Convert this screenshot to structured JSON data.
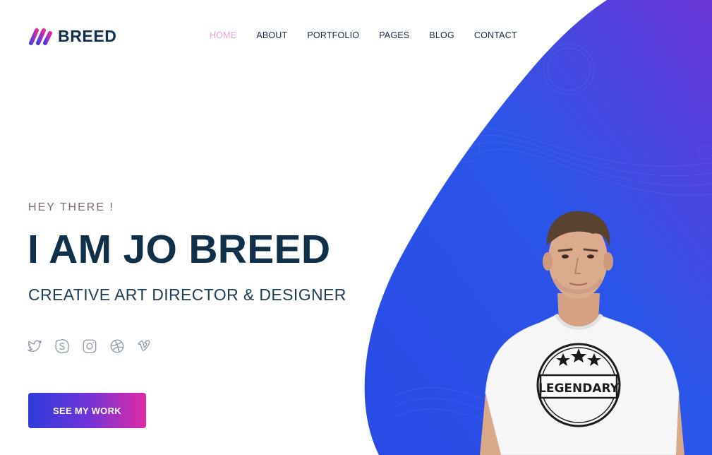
{
  "brand": {
    "name": "BREED"
  },
  "nav": {
    "items": [
      {
        "label": "HOME",
        "active": true
      },
      {
        "label": "ABOUT",
        "active": false
      },
      {
        "label": "PORTFOLIO",
        "active": false
      },
      {
        "label": "PAGES",
        "active": false
      },
      {
        "label": "BLOG",
        "active": false
      },
      {
        "label": "CONTACT",
        "active": false
      }
    ]
  },
  "hero": {
    "eyebrow": "HEY THERE !",
    "title": "I AM JO BREED",
    "subtitle": "CREATIVE ART DIRECTOR & DESIGNER",
    "cta_label": "SEE MY WORK"
  },
  "socials": [
    "twitter-icon",
    "skype-icon",
    "instagram-icon",
    "dribbble-icon",
    "vimeo-icon"
  ],
  "portrait": {
    "shirt_text": "LEGENDARY"
  },
  "colors": {
    "brand_dark": "#0f2f4d",
    "nav_active": "#e9a2d4",
    "blob_start": "#2a4ae6",
    "blob_end": "#6a34d6",
    "cta_start": "#2e3bdc",
    "cta_end": "#e02aa6"
  }
}
